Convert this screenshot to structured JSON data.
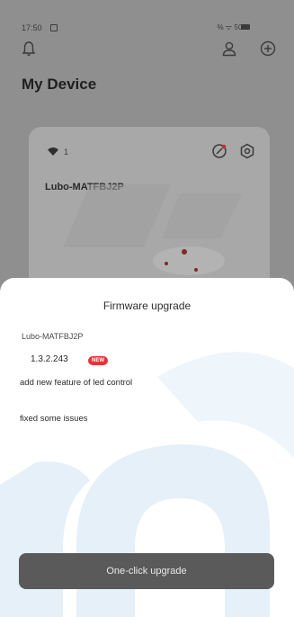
{
  "status_bar": {
    "time": "17:50",
    "right_text": "% ᯤ 5G"
  },
  "header": {
    "title": "My Device"
  },
  "device_card": {
    "wifi_count": "1",
    "name": "Lubo-MATFBJ2P"
  },
  "firmware_sheet": {
    "title": "Firmware upgrade",
    "device_name": "Lubo-MATFBJ2P",
    "version": "1.3.2.243",
    "badge": "NEW",
    "notes": [
      "add new feature of led control",
      "fixed some issues"
    ],
    "button_label": "One-click upgrade"
  },
  "colors": {
    "accent_badge": "#e8323c",
    "button_bg": "#5a5a5a",
    "watermark": "#e5f0f9"
  }
}
